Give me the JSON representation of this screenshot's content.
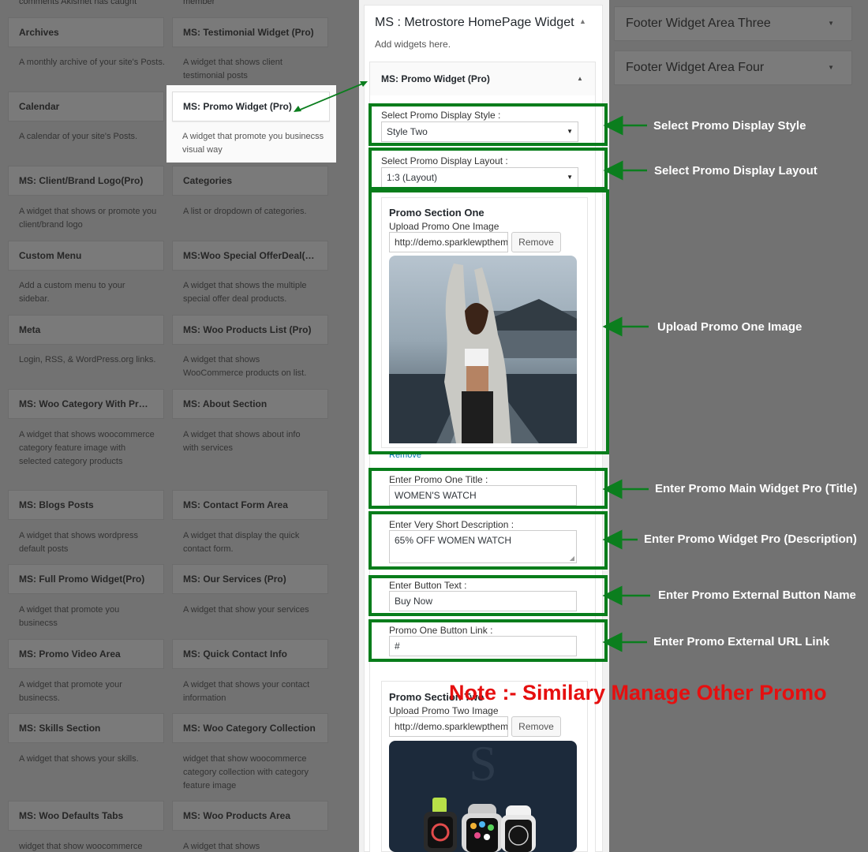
{
  "library": {
    "top_left_text": "comments Akismet has caught",
    "top_right_text": "member",
    "left_column": [
      {
        "title": "Archives",
        "desc": "A monthly archive of your site's Posts."
      },
      {
        "title": "Calendar",
        "desc": "A calendar of your site's Posts."
      },
      {
        "title": "MS: Client/Brand Logo(Pro)",
        "desc": "A widget that shows or promote you client/brand logo"
      },
      {
        "title": "Custom Menu",
        "desc": "Add a custom menu to your sidebar."
      },
      {
        "title": "Meta",
        "desc": "Login, RSS, & WordPress.org links."
      },
      {
        "title": "MS: Woo Category With Prod...",
        "desc": "A widget that shows woocommerce category feature image with selected category products"
      },
      {
        "title": "MS: Blogs Posts",
        "desc": "A widget that shows wordpress default posts"
      },
      {
        "title": "MS: Full Promo Widget(Pro)",
        "desc": "A widget that promote you businecss"
      },
      {
        "title": "MS: Promo Video Area",
        "desc": "A widget that promote your businecss."
      },
      {
        "title": "MS: Skills Section",
        "desc": "A widget that shows your skills."
      },
      {
        "title": "MS: Woo Defaults Tabs",
        "desc": "widget that show woocommerce"
      }
    ],
    "right_column": [
      {
        "title": "MS: Testimonial Widget (Pro)",
        "desc": "A widget that shows client testimonial posts"
      },
      {
        "title": "MS: Promo Widget (Pro)",
        "desc": "A widget that promote you businecss visual way"
      },
      {
        "title": "Categories",
        "desc": "A list or dropdown of categories."
      },
      {
        "title": "MS:Woo Special OfferDeal(Pr...",
        "desc": "A widget that shows the multiple special offer deal products."
      },
      {
        "title": "MS: Woo Products List (Pro)",
        "desc": "A widget that shows WooCommerce products on list."
      },
      {
        "title": "MS: About Section",
        "desc": "A widget that shows about info with services"
      },
      {
        "title": "MS: Contact Form Area",
        "desc": "A widget that display the quick contact form."
      },
      {
        "title": "MS: Our Services (Pro)",
        "desc": "A widget that show your services"
      },
      {
        "title": "MS: Quick Contact Info",
        "desc": "A widget that shows your contact information"
      },
      {
        "title": "MS: Woo Category Collection",
        "desc": "widget that show woocommerce category collection with category feature image"
      },
      {
        "title": "MS: Woo Products Area",
        "desc": "A widget that shows"
      }
    ]
  },
  "area": {
    "title": "MS : Metrostore HomePage Widget",
    "subtitle": "Add widgets here.",
    "widget_title": "MS: Promo Widget (Pro)",
    "style_label": "Select Promo Display Style :",
    "style_value": "Style Two",
    "layout_label": "Select Promo Display Layout :",
    "layout_value": "1:3 (Layout)",
    "section_one": {
      "title": "Promo Section One",
      "upload_label": "Upload Promo One Image",
      "url": "http://demo.sparklewpthemes.com",
      "remove_btn": "Remove",
      "remove_link": "Remove"
    },
    "title_label": "Enter Promo One Title :",
    "title_value": "WOMEN'S WATCH",
    "desc_label": "Enter Very Short Description :",
    "desc_value": "65% OFF WOMEN WATCH",
    "btn_label": "Enter Button Text :",
    "btn_value": "Buy Now",
    "link_label": "Promo One Button Link :",
    "link_value": "#",
    "section_two": {
      "title": "Promo Section Two",
      "upload_label": "Upload Promo Two Image",
      "url": "http://demo.sparklewpthemes.com",
      "remove_btn": "Remove"
    }
  },
  "footer_areas": [
    "Footer Widget Area Three",
    "Footer Widget Area Four"
  ],
  "annotations": {
    "style": "Select Promo Display Style",
    "layout": "Select Promo Display Layout",
    "image": "Upload Promo One Image",
    "title": "Enter Promo Main Widget Pro (Title)",
    "desc": "Enter Promo Widget Pro (Description)",
    "button": "Enter Promo External Button Name",
    "url": "Enter Promo External URL Link",
    "note": "Note :- Similary Manage Other Promo"
  },
  "colors": {
    "annotation_green": "#087d1b",
    "note_red": "#e60f0f",
    "overlay_gray": "#727272"
  }
}
